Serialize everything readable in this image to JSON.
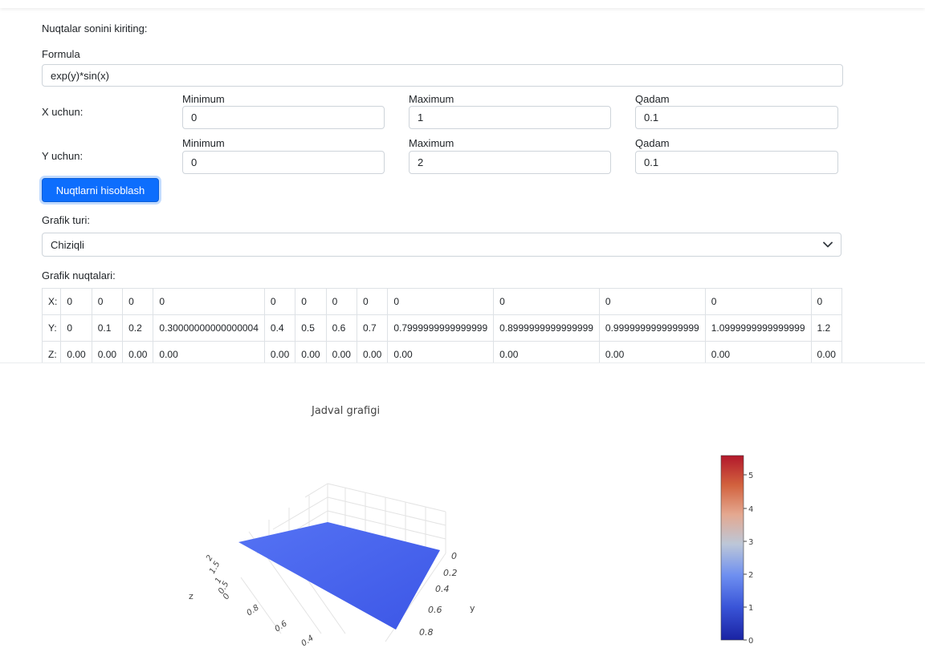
{
  "header": {
    "points_label": "Nuqtalar sonini kiriting:"
  },
  "formula": {
    "label": "Formula",
    "value": "exp(y)*sin(x)"
  },
  "x_row": {
    "label": "X uchun:",
    "min_label": "Minimum",
    "min_value": "0",
    "max_label": "Maximum",
    "max_value": "1",
    "step_label": "Qadam",
    "step_value": "0.1"
  },
  "y_row": {
    "label": "Y uchun:",
    "min_label": "Minimum",
    "min_value": "0",
    "max_label": "Maximum",
    "max_value": "2",
    "step_label": "Qadam",
    "step_value": "0.1"
  },
  "calc_button": "Nuqtlarni hisoblash",
  "chart_type": {
    "label": "Grafik turi:",
    "selected": "Chiziqli"
  },
  "points": {
    "label": "Grafik nuqtalari:",
    "rows": [
      {
        "head": "X:",
        "cells": [
          "0",
          "0",
          "0",
          "0",
          "0",
          "0",
          "0",
          "0",
          "0",
          "0",
          "0",
          "0",
          "0"
        ]
      },
      {
        "head": "Y:",
        "cells": [
          "0",
          "0.1",
          "0.2",
          "0.30000000000000004",
          "0.4",
          "0.5",
          "0.6",
          "0.7",
          "0.7999999999999999",
          "0.8999999999999999",
          "0.9999999999999999",
          "1.0999999999999999",
          "1.2"
        ]
      },
      {
        "head": "Z:",
        "cells": [
          "0.00",
          "0.00",
          "0.00",
          "0.00",
          "0.00",
          "0.00",
          "0.00",
          "0.00",
          "0.00",
          "0.00",
          "0.00",
          "0.00",
          "0.00"
        ]
      }
    ]
  },
  "chart_data": {
    "type": "surface",
    "title": "Jadval grafigi",
    "axes": {
      "x": {
        "title": "",
        "ticks": [
          "0.8",
          "0.6",
          "0.4"
        ]
      },
      "y": {
        "title": "y",
        "ticks": [
          "0",
          "0.2",
          "0.4",
          "0.6",
          "0.8"
        ]
      },
      "z": {
        "title": "z",
        "ticks": [
          "2",
          "1.5",
          "1",
          "0.5",
          "0"
        ]
      }
    },
    "colorbar": {
      "ticks": [
        "5",
        "4",
        "3",
        "2",
        "1",
        "0"
      ],
      "range": [
        0,
        5.5
      ],
      "colors": [
        "#1a23a3",
        "#3a55d8",
        "#6e8ff0",
        "#bcc7d8",
        "#e4a890",
        "#d2623e",
        "#b2182b"
      ]
    },
    "surface_color": "#4c6af0"
  }
}
